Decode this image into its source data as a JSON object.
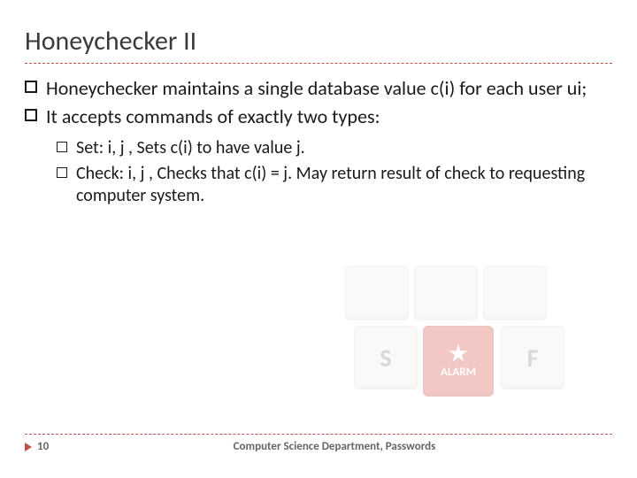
{
  "slide": {
    "title": "Honeychecker II",
    "bullets": {
      "b1": "Honeychecker maintains a single database value c(i) for each user ui;",
      "b2": "It accepts commands of exactly two types:"
    },
    "sub": {
      "s1": " Set: i, j  , Sets c(i) to have value j.",
      "s2": " Check: i, j , Checks that c(i) = j. May return result of check to requesting computer system."
    },
    "footer": {
      "page": "10",
      "text": "Computer Science Department, Passwords"
    },
    "art": {
      "alarm_label": "ALARM",
      "keys": {
        "s": "S",
        "f": "F"
      }
    }
  }
}
